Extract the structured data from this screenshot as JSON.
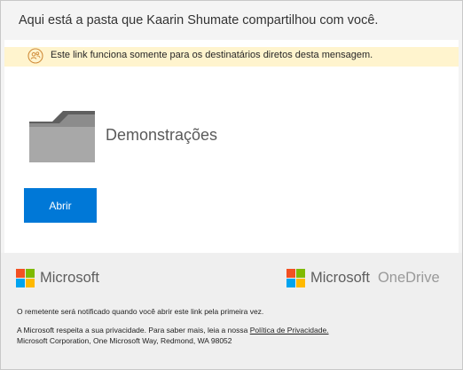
{
  "header": {
    "title": "Aqui está a pasta que Kaarin Shumate compartilhou com você."
  },
  "notice": {
    "icon": "people-share-icon",
    "text": "Este link funciona somente para os destinatários diretos desta mensagem.",
    "background": "#fff4ce",
    "icon_color": "#d08c3a"
  },
  "folder": {
    "icon": "folder-icon",
    "name": "Demonstrações"
  },
  "actions": {
    "open_label": "Abrir",
    "open_color": "#0078d7"
  },
  "footer": {
    "microsoft_label": "Microsoft",
    "onedrive_microsoft_label": "Microsoft",
    "onedrive_label": "OneDrive",
    "notify_text": "O remetente será notificado quando você abrir este link pela primeira vez.",
    "privacy_text": "A Microsoft respeita a sua privacidade. Para saber mais, leia a nossa",
    "privacy_link": "Política de Privacidade.",
    "address": "Microsoft Corporation, One Microsoft Way, Redmond, WA 98052",
    "logo_colors": [
      "#f25022",
      "#7fba00",
      "#00a4ef",
      "#ffb900"
    ]
  }
}
